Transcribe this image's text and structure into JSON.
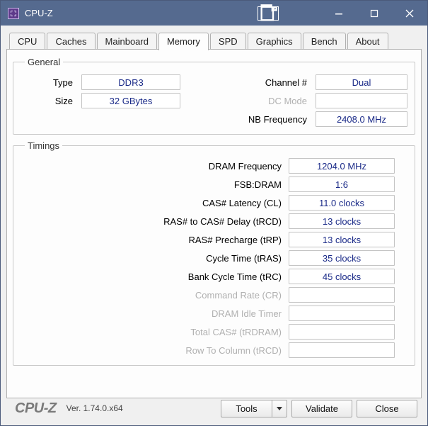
{
  "window": {
    "title": "CPU-Z"
  },
  "tabs": [
    "CPU",
    "Caches",
    "Mainboard",
    "Memory",
    "SPD",
    "Graphics",
    "Bench",
    "About"
  ],
  "active_tab": "Memory",
  "general": {
    "legend": "General",
    "labels": {
      "type": "Type",
      "size": "Size",
      "channel": "Channel #",
      "dc_mode": "DC Mode",
      "nb_freq": "NB Frequency"
    },
    "values": {
      "type": "DDR3",
      "size": "32 GBytes",
      "channel": "Dual",
      "dc_mode": "",
      "nb_freq": "2408.0 MHz"
    }
  },
  "timings": {
    "legend": "Timings",
    "rows": [
      {
        "label": "DRAM Frequency",
        "value": "1204.0 MHz",
        "enabled": true
      },
      {
        "label": "FSB:DRAM",
        "value": "1:6",
        "enabled": true
      },
      {
        "label": "CAS# Latency (CL)",
        "value": "11.0 clocks",
        "enabled": true
      },
      {
        "label": "RAS# to CAS# Delay (tRCD)",
        "value": "13 clocks",
        "enabled": true
      },
      {
        "label": "RAS# Precharge (tRP)",
        "value": "13 clocks",
        "enabled": true
      },
      {
        "label": "Cycle Time (tRAS)",
        "value": "35 clocks",
        "enabled": true
      },
      {
        "label": "Bank Cycle Time (tRC)",
        "value": "45 clocks",
        "enabled": true
      },
      {
        "label": "Command Rate (CR)",
        "value": "",
        "enabled": false
      },
      {
        "label": "DRAM Idle Timer",
        "value": "",
        "enabled": false
      },
      {
        "label": "Total CAS# (tRDRAM)",
        "value": "",
        "enabled": false
      },
      {
        "label": "Row To Column (tRCD)",
        "value": "",
        "enabled": false
      }
    ]
  },
  "footer": {
    "brand": "CPU-Z",
    "version": "Ver. 1.74.0.x64",
    "tools": "Tools",
    "validate": "Validate",
    "close": "Close"
  }
}
